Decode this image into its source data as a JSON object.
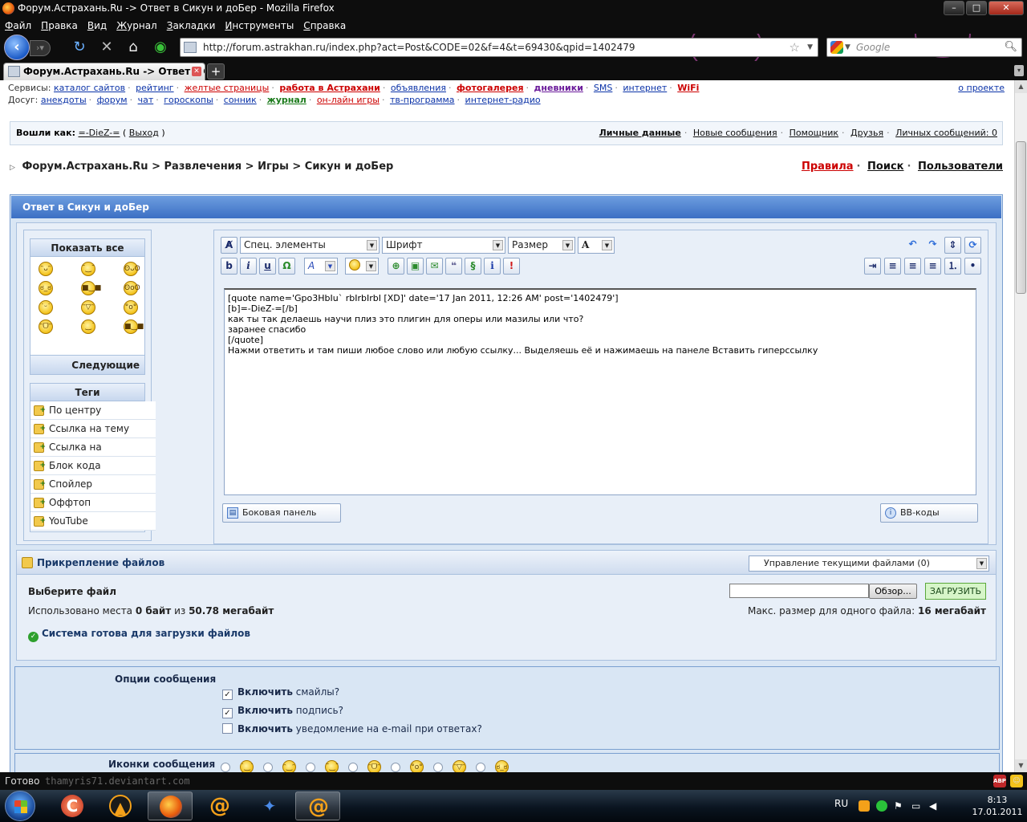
{
  "window": {
    "title": "Форум.Астрахань.Ru -> Ответ в Сикун и доБер - Mozilla Firefox"
  },
  "menu": [
    "Файл",
    "Правка",
    "Вид",
    "Журнал",
    "Закладки",
    "Инструменты",
    "Справка"
  ],
  "nav": {
    "url": "http://forum.astrakhan.ru/index.php?act=Post&CODE=02&f=4&t=69430&qpid=1402479",
    "search_placeholder": "Google"
  },
  "tab": {
    "label": "Форум.Астрахань.Ru -> Ответ в Сик...",
    "new_tab": "+"
  },
  "services": {
    "label": "Сервисы:",
    "links": [
      "каталог сайтов",
      "рейтинг",
      "желтые страницы",
      "работа в Астрахани",
      "объявления",
      "фотогалерея",
      "дневники",
      "SMS",
      "интернет",
      "WiFi"
    ],
    "about": "о проекте"
  },
  "leisure": {
    "label": "Досуг:",
    "links": [
      "анекдоты",
      "форум",
      "чат",
      "гороскопы",
      "сонник",
      "журнал",
      "он-лайн игры",
      "тв-программа",
      "интернет-радио"
    ]
  },
  "userbar": {
    "logged_as": "Вошли как:",
    "username": "=-DieZ-=",
    "logout": "Выход",
    "links": [
      "Личные данные",
      "Новые сообщения",
      "Помощник",
      "Друзья",
      "Личных сообщений: 0"
    ]
  },
  "breadcrumb": {
    "items": [
      "Форум.Астрахань.Ru",
      "Развлечения",
      "Игры",
      "Сикун и доБер"
    ],
    "links": [
      "Правила",
      "Поиск",
      "Пользователи"
    ]
  },
  "reply": {
    "title": "Ответ в Сикун и доБер"
  },
  "smilies": {
    "show_all": "Показать все",
    "next": "Следующие",
    "glyphs": [
      [
        "ᵔᴗᵔ",
        "˘‿˘",
        "ʘᴗʘ"
      ],
      [
        "ಠ_ಠ",
        "■‿■",
        "ʘoʘ"
      ],
      [
        "˙ᵕ˙",
        "ᵔ▽ᵔ",
        "°o°"
      ],
      [
        "ᵔᗜᵔ",
        "˙‿˙",
        "■‿■"
      ]
    ]
  },
  "tags": {
    "title": "Теги",
    "items": [
      "По центру",
      "Ссылка на тему",
      "Ссылка на сообщение",
      "Блок кода",
      "Спойлер",
      "Оффтоп",
      "YouTube"
    ]
  },
  "editor": {
    "special": "Спец. элементы",
    "font": "Шрифт",
    "size": "Размер",
    "text": "[quote name='Gpo3HbIu` rbIrbIrbI [XD]' date='17 Jan 2011, 12:26 AM' post='1402479']\n[b]=-DieZ-=[/b]\nкак ты так делаешь научи плиз это плигин для оперы или мазилы или что?\nзаранее спасибо\n[/quote]\nНажми ответить и там пиши любое слово или любую ссылку... Выделяешь её и нажимаешь на панеле Вставить гиперссылку",
    "side_panel": "Боковая панель",
    "bbcodes": "BB-коды"
  },
  "attach": {
    "title": "Прикрепление файлов",
    "manage": "Управление текущими файлами (0)",
    "choose": "Выберите файл",
    "used_prefix": "Использовано места",
    "used_value": "0 байт",
    "used_of": "из",
    "used_total": "50.78 мегабайт",
    "browse": "Обзор...",
    "upload": "ЗАГРУЗИТЬ",
    "max_prefix": "Макс. размер для одного файла:",
    "max_value": "16 мегабайт",
    "ready": "Система готова для загрузки файлов"
  },
  "options": {
    "title": "Опции сообщения",
    "enable": "Включить",
    "smilies": "смайлы?",
    "signature": "подпись?",
    "email": "уведомление на e-mail при ответах?"
  },
  "icons": {
    "title": "Иконки сообщения",
    "glyphs": [
      "˙‿˙",
      "ᵔ‿ᵔ",
      "˘‿˘",
      "ᵔᗜᵔ",
      "°o°",
      "ᵔ▽ᵔ",
      "ಠ_ಠ"
    ]
  },
  "status": {
    "text": "Готово",
    "credit": "thamyris71.deviantart.com"
  },
  "taskbar": {
    "lang": "RU",
    "time": "8:13",
    "date": "17.01.2011"
  }
}
